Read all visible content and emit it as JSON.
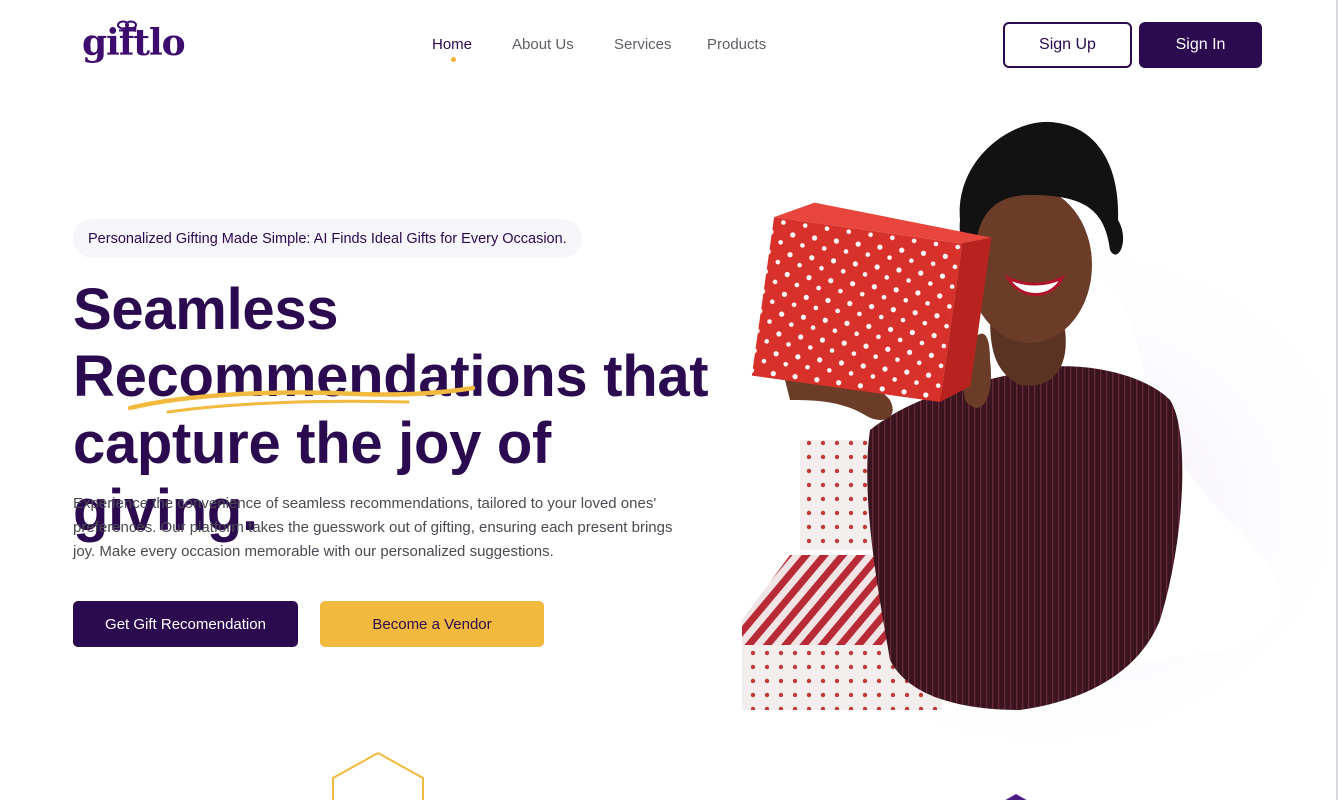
{
  "header": {
    "logo_text": "giftlo",
    "nav": [
      {
        "label": "Home",
        "active": true
      },
      {
        "label": "About Us",
        "active": false
      },
      {
        "label": "Services",
        "active": false
      },
      {
        "label": "Products",
        "active": false
      }
    ],
    "signup_label": "Sign Up",
    "signin_label": "Sign In"
  },
  "hero": {
    "tagline": "Personalized Gifting Made Simple: AI Finds Ideal Gifts for Every Occasion.",
    "headline": {
      "line1": "Seamless",
      "line2_strong": "Recommendations",
      "line2_rest": " that",
      "line3": "capture the joy of giving."
    },
    "description": "Experience the convenience of seamless recommendations, tailored to your loved ones' preferences. Our platform takes the guesswork out of gifting, ensuring each present brings joy. Make every occasion memorable with our personalized suggestions.",
    "primary_cta": "Get Gift Recomendation",
    "secondary_cta": "Become a Vendor"
  },
  "colors": {
    "brand_purple": "#2b0a4f",
    "accent_yellow": "#f2b93f",
    "gift_red": "#d8302b"
  },
  "icons": {
    "logo_bow": "gift-bow-icon",
    "nav_indicator": "active-dot-icon"
  }
}
